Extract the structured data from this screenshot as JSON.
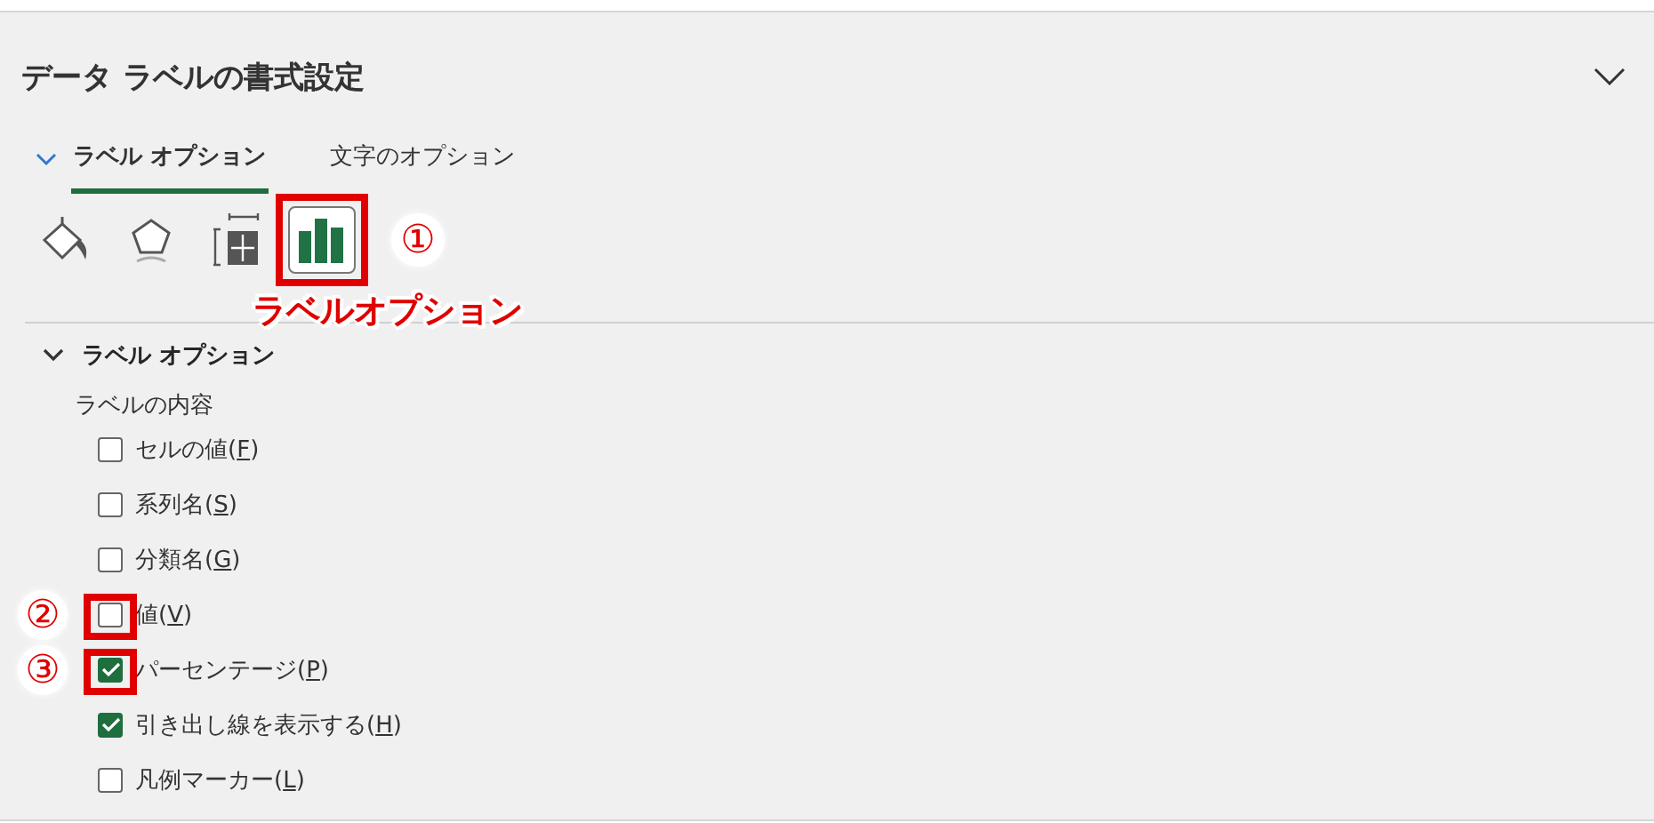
{
  "panel": {
    "title": "データ ラベルの書式設定"
  },
  "tabs": [
    {
      "label": "ラベル オプション",
      "selected": true
    },
    {
      "label": "文字のオプション",
      "selected": false
    }
  ],
  "icon_tabs": [
    {
      "kind": "fill",
      "selected": false,
      "highlighted": false
    },
    {
      "kind": "effects",
      "selected": false,
      "highlighted": false
    },
    {
      "kind": "size",
      "selected": false,
      "highlighted": false
    },
    {
      "kind": "chart",
      "selected": true,
      "highlighted": true,
      "callout": "①",
      "caption": "ラベルオプション"
    }
  ],
  "section": {
    "title": "ラベル オプション",
    "expanded": true,
    "group_label": "ラベルの内容",
    "options": [
      {
        "before": "セルの値(",
        "key": "F",
        "after": ")",
        "checked": false,
        "highlighted": false
      },
      {
        "before": "系列名(",
        "key": "S",
        "after": ")",
        "checked": false,
        "highlighted": false
      },
      {
        "before": "分類名(",
        "key": "G",
        "after": ")",
        "checked": false,
        "highlighted": false
      },
      {
        "before": "値(",
        "key": "V",
        "after": ")",
        "checked": false,
        "highlighted": true,
        "callout": "②"
      },
      {
        "before": "パーセンテージ(",
        "key": "P",
        "after": ")",
        "checked": true,
        "highlighted": true,
        "callout": "③"
      },
      {
        "before": "引き出し線を表示する(",
        "key": "H",
        "after": ")",
        "checked": true,
        "highlighted": false
      },
      {
        "before": "凡例マーカー(",
        "key": "L",
        "after": ")",
        "checked": false,
        "highlighted": false
      }
    ]
  }
}
